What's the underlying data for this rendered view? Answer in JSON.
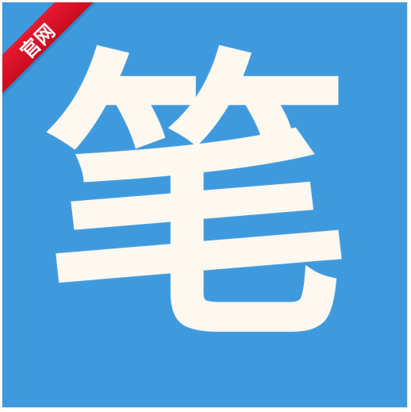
{
  "app_icon": {
    "glyph": "笔",
    "ribbon_label": "官网",
    "colors": {
      "tile_background": "#3f99dd",
      "glyph": "#fdf8f0",
      "ribbon": "#d8122a",
      "ribbon_text": "#ffffff"
    }
  }
}
